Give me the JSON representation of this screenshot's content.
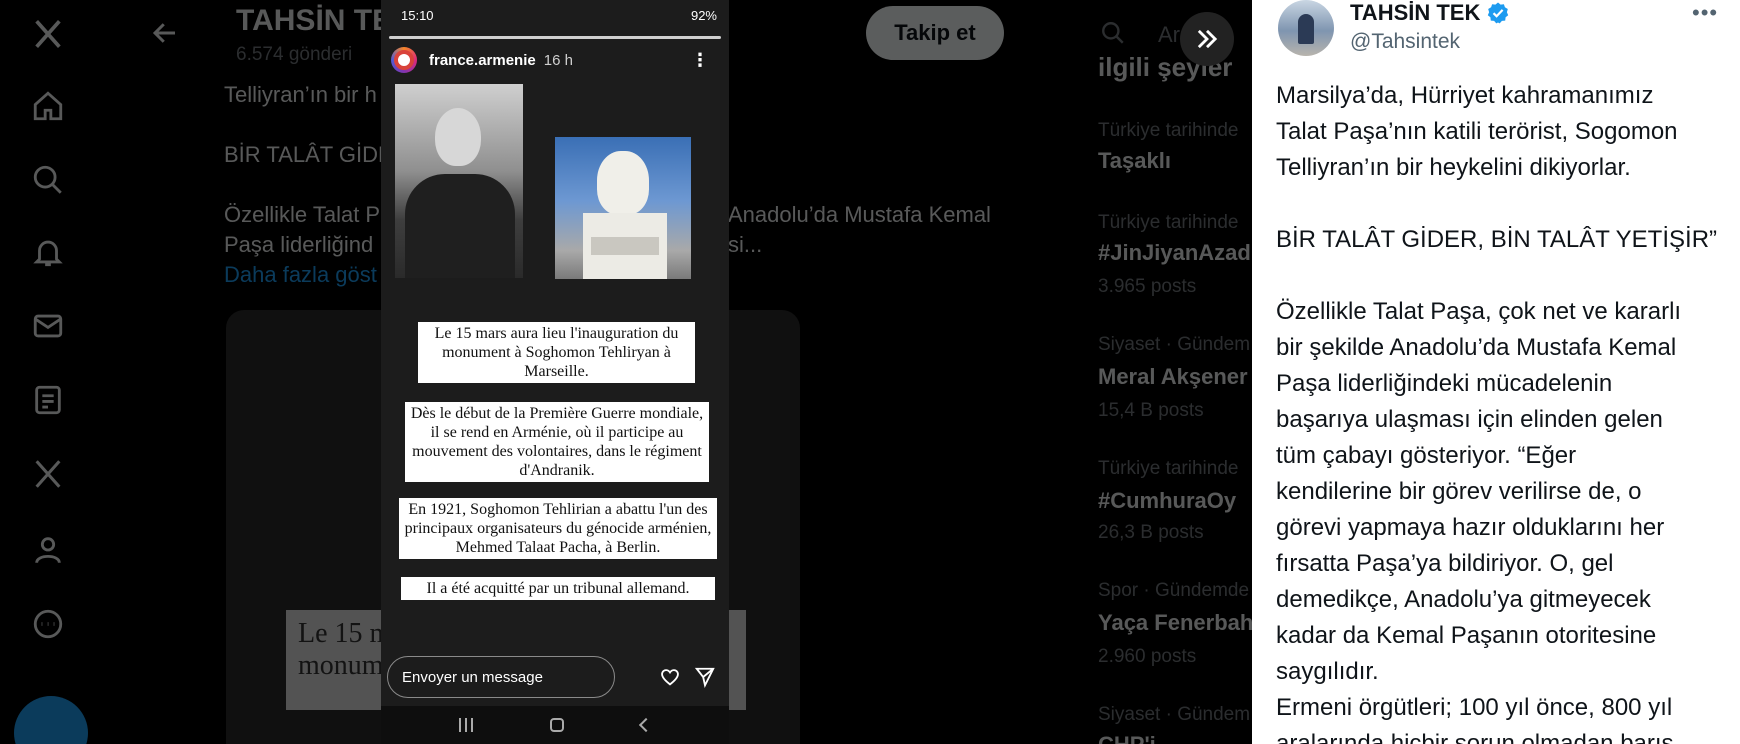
{
  "background": {
    "title": "TAHSİN TE",
    "subtitle": "6.574 gönderi",
    "follow_label": "Takip et",
    "text_lines": [
      "Telliyran’ın bir h",
      "BİR TALÂT GİDE",
      "Özellikle Talat P",
      "Anadolu’da Mustafa Kemal",
      "Paşa liderliğind",
      "si..."
    ],
    "show_more": "Daha fazla göst",
    "media_caption_1": "Le 15 m",
    "media_caption_2": "monum",
    "search_placeholder": "Ar",
    "trends_title": "ilgili şeyler",
    "trends": [
      {
        "category": "Türkiye tarihinde",
        "name": "Taşaklı",
        "count": ""
      },
      {
        "category": "Türkiye tarihinde",
        "name": "#JinJiyanAzad",
        "count": "3.965 posts"
      },
      {
        "category": "Siyaset · Gündem",
        "name": "Meral Akşener",
        "count": "15,4 B posts"
      },
      {
        "category": "Türkiye tarihinde",
        "name": "#CumhuraOy",
        "count": "26,3 B posts"
      },
      {
        "category": "Spor · Gündemde",
        "name": "Yaça Fenerbah",
        "count": "2.960 posts"
      },
      {
        "category": "Siyaset · Gündem",
        "name": "CHP'i",
        "count": ""
      }
    ]
  },
  "phone": {
    "status_time": "15:10",
    "status_right": "92%",
    "story_user": "france.armenie",
    "story_time": "16 h",
    "captions": [
      "Le 15 mars aura lieu l'inauguration du monument à Soghomon Tehliryan à Marseille.",
      "Dès le début de la Première Guerre mondiale, il se rend en Arménie, où il participe au mouvement des volontaires, dans le régiment d'Andranik.",
      "En 1921, Soghomon Tehlirian a abattu l'un des principaux organisateurs du génocide arménien, Mehmed Talaat Pacha, à Berlin.",
      "Il a été acquitté par un tribunal allemand."
    ],
    "message_placeholder": "Envoyer un message"
  },
  "tweet": {
    "author_name": "TAHSİN TEK",
    "author_handle": "@Tahsintek",
    "lines": [
      "Marsilya’da, Hürriyet kahramanımız",
      "Talat Paşa’nın katili terörist, Sogomon",
      "Telliyran’ın bir heykelini dikiyorlar.",
      "",
      "BİR TALÂT GİDER, BİN TALÂT YETİŞİR”",
      "",
      "Özellikle Talat Paşa, çok net ve kararlı",
      "bir şekilde Anadolu’da Mustafa Kemal",
      "Paşa liderliğindeki mücadelenin",
      "başarıya ulaşması için elinden gelen",
      "tüm çabayı gösteriyor. “Eğer",
      "kendilerine bir görev verilirse de, o",
      "görevi yapmaya hazır olduklarını her",
      "fırsatta Paşa’ya bildiriyor. O, gel",
      "demedikçe, Anadolu’ya gitmeyecek",
      "kadar da Kemal Paşanın otoritesine",
      "saygılıdır.",
      "Ermeni örgütleri; 100 yıl önce, 800 yıl",
      "aralarında hiçbir sorun olmadan barış"
    ]
  },
  "colors": {
    "accent": "#1d9bf0",
    "panel_bg": "#ffffff",
    "page_bg": "#000000"
  }
}
